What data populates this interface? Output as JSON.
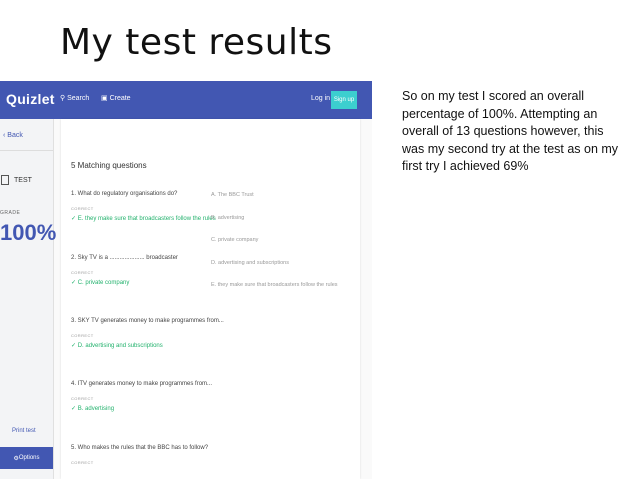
{
  "slide": {
    "title": "My test results",
    "description": "So on my test I scored an overall percentage of 100%. Attempting an overall of 13 questions however, this was my second try at the test as on my first try I achieved 69%"
  },
  "quizlet": {
    "logo": "Quizlet",
    "topbar": {
      "search": "Search",
      "create": "Create",
      "login": "Log in",
      "signup": "Sign up"
    },
    "sidebar": {
      "back": "Back",
      "test": "TEST",
      "grade_label": "GRADE",
      "grade": "100%",
      "print": "Print test",
      "options": "Options"
    },
    "section_title": "5 Matching questions",
    "questions": [
      {
        "text": "1. What do regulatory organisations do?",
        "status": "CORRECT",
        "answer": "✓ E. they make sure that broadcasters follow the rules"
      },
      {
        "text": "2. Sky TV is a ..................... broadcaster",
        "status": "CORRECT",
        "answer": "✓ C. private company"
      },
      {
        "text": "3. SKY TV generates money to make programmes from...",
        "status": "CORRECT",
        "answer": "✓ D. advertising and subscriptions"
      },
      {
        "text": "4. ITV generates money to make programmes from...",
        "status": "CORRECT",
        "answer": "✓ B. advertising"
      },
      {
        "text": "5. Who makes the rules that the BBC has to follow?",
        "status": "CORRECT",
        "answer": ""
      }
    ],
    "options": [
      "A. The BBC Trust",
      "B. advertising",
      "C. private company",
      "D. advertising and subscriptions",
      "E. they make sure that broadcasters follow the rules"
    ]
  }
}
